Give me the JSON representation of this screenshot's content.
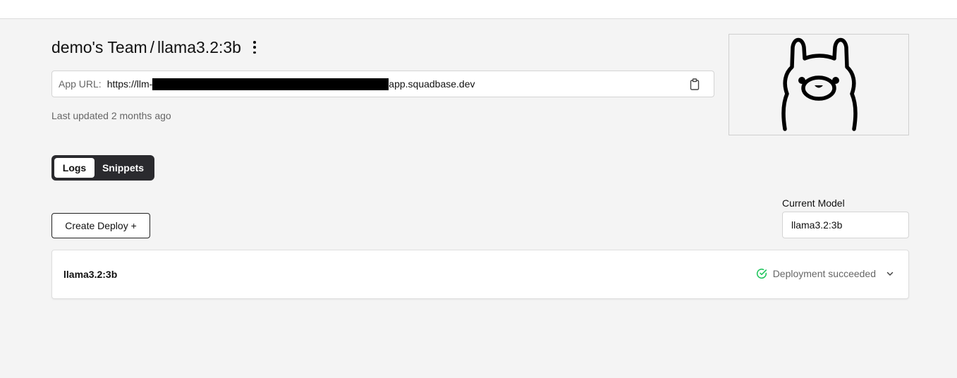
{
  "header": {
    "team": "demo's Team",
    "separator": "/",
    "app_name": "llama3.2:3b"
  },
  "url": {
    "label": "App URL:",
    "prefix": "https://llm-",
    "suffix": "app.squadbase.dev"
  },
  "last_updated": "Last updated 2 months ago",
  "tabs": [
    {
      "label": "Logs",
      "active": true
    },
    {
      "label": "Snippets",
      "active": false
    }
  ],
  "create_button_label": "Create Deploy +",
  "current_model": {
    "label": "Current Model",
    "value": "llama3.2:3b"
  },
  "deployment": {
    "name": "llama3.2:3b",
    "status": "Deployment succeeded"
  },
  "icons": {
    "menu": "kebab-menu-icon",
    "copy": "clipboard-icon",
    "status": "check-circle-icon",
    "expand": "chevron-down-icon",
    "image": "llama-logo"
  },
  "colors": {
    "success": "#22c55e",
    "tab_bg": "#2a2a2e",
    "page_bg": "#f4f4f4"
  }
}
